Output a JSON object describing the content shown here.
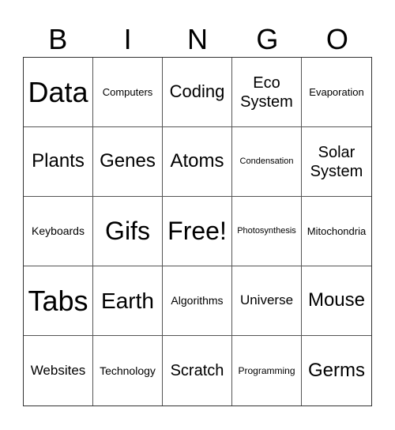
{
  "header": [
    "B",
    "I",
    "N",
    "G",
    "O"
  ],
  "cells": [
    {
      "text": "Data",
      "size": "s36"
    },
    {
      "text": "Computers",
      "size": "s13"
    },
    {
      "text": "Coding",
      "size": "s22"
    },
    {
      "text": "Eco System",
      "size": "s20"
    },
    {
      "text": "Evaporation",
      "size": "s13"
    },
    {
      "text": "Plants",
      "size": "s24"
    },
    {
      "text": "Genes",
      "size": "s24"
    },
    {
      "text": "Atoms",
      "size": "s24"
    },
    {
      "text": "Condensation",
      "size": "s11"
    },
    {
      "text": "Solar System",
      "size": "s20"
    },
    {
      "text": "Keyboards",
      "size": "s14"
    },
    {
      "text": "Gifs",
      "size": "s32"
    },
    {
      "text": "Free!",
      "size": "s32"
    },
    {
      "text": "Photosynthesis",
      "size": "s11"
    },
    {
      "text": "Mitochondria",
      "size": "s13"
    },
    {
      "text": "Tabs",
      "size": "s36"
    },
    {
      "text": "Earth",
      "size": "s28"
    },
    {
      "text": "Algorithms",
      "size": "s14"
    },
    {
      "text": "Universe",
      "size": "s17"
    },
    {
      "text": "Mouse",
      "size": "s24"
    },
    {
      "text": "Websites",
      "size": "s17"
    },
    {
      "text": "Technology",
      "size": "s14"
    },
    {
      "text": "Scratch",
      "size": "s20"
    },
    {
      "text": "Programming",
      "size": "s12"
    },
    {
      "text": "Germs",
      "size": "s24"
    }
  ]
}
